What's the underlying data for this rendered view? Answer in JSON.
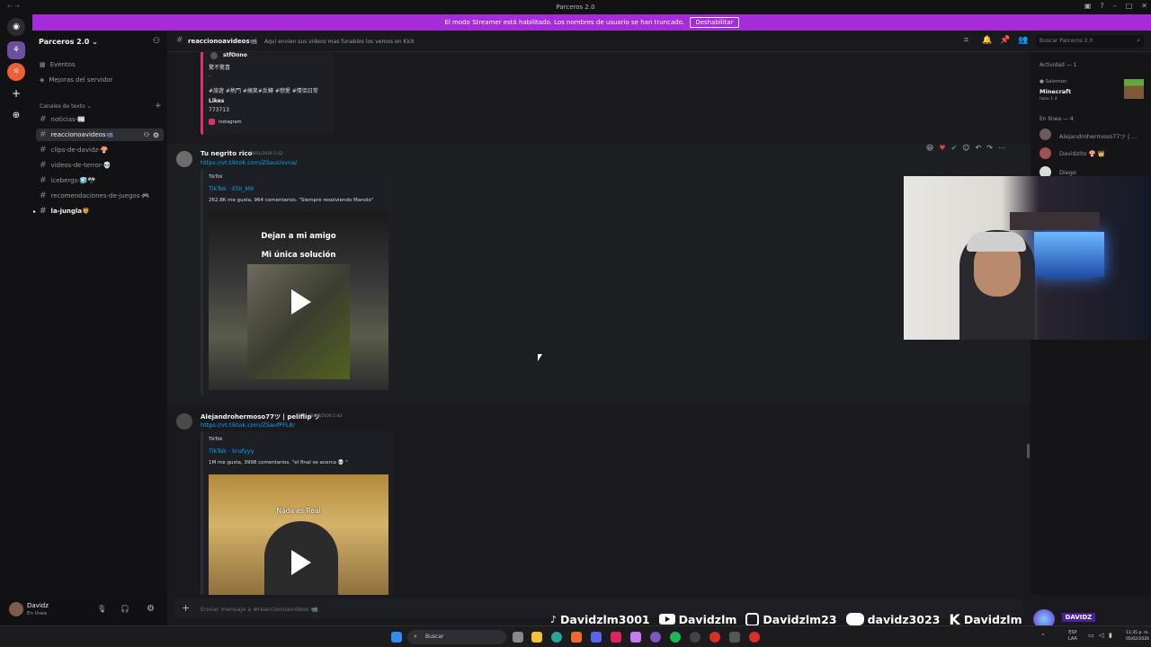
{
  "window": {
    "title": "Parceros 2.0",
    "nav": "← →"
  },
  "banner": {
    "text": "El modo Streamer está habilitado. Los nombres de usuario se han truncado.",
    "button": "Deshabilitar"
  },
  "sidebar": {
    "guild_name": "Parceros 2.0",
    "items": [
      {
        "label": "Eventos"
      },
      {
        "label": "Mejoras del servidor"
      }
    ],
    "category": "Canales de texto",
    "channels": [
      {
        "name": "noticias-",
        "emoji": "📰"
      },
      {
        "name": "reaccionoavideos",
        "emoji": "📹"
      },
      {
        "name": "clips-de-davidz-",
        "emoji": "🍄"
      },
      {
        "name": "videos-de-terror-",
        "emoji": "💀"
      },
      {
        "name": "icebergs-",
        "emoji": "🧊🎌"
      },
      {
        "name": "recomendaciones-de-juegos-",
        "emoji": "🎮"
      },
      {
        "name": "la-jungla",
        "emoji": "🦁"
      }
    ]
  },
  "user": {
    "name": "Davidz",
    "status": "En línea"
  },
  "header": {
    "channel": "reaccionoavideos",
    "channel_emoji": "📹",
    "topic": "Aqui envien sus videos mas funables los vemos en Kick",
    "search_placeholder": "Buscar Parceros 2.0"
  },
  "messages": {
    "prev_embed": {
      "username": "stfOnno",
      "line1": "驚不驚喜",
      "dot": ".",
      "hashtags": "#旅遊 #熱門 #搞笑#反轉 #戀愛 #情侶日常",
      "likes_label": "Likes",
      "likes": "773713",
      "source": "Instagram"
    },
    "msg1": {
      "author": "Tu negrito rico",
      "time": "28/01/2026 1:32",
      "link": "https://vt.tiktok.com/ZSauUsvna/",
      "provider": "TikTok",
      "embed_title": "TikTok · EDI_M9",
      "description": "262.8K me gusta, 964 comentarios. \"Siempre resolviendo Manolo\"",
      "video_line1": "Dejan a mi amigo",
      "video_line2": "Mi única solución"
    },
    "msg2": {
      "author": "Alejandrohermoso77ツ | pelifliр ツ",
      "time": "28/01/2026 1:42",
      "link": "https://vt.tiktok.com/ZSaufPFL8/",
      "provider": "TikTok",
      "embed_title": "TikTok · krufyyy",
      "description": "1M me gusta, 3998 comentarios. \"el final se acerca 💀 \"",
      "video_text": "Nada es Real"
    }
  },
  "composer": {
    "placeholder": "Enviar mensaje a #reaccionoavideos 📹"
  },
  "members": {
    "activity_header": "Actividad — 1",
    "activity": {
      "user": "Salomón",
      "game": "Minecraft",
      "ago": "hace 1 d"
    },
    "online_header": "En línea — 4",
    "online": [
      {
        "name": "Alejandrohermoso77ツ | ..."
      },
      {
        "name": "Davidzito 🍄 👑"
      },
      {
        "name": "Diego"
      }
    ]
  },
  "overlay": {
    "tiktok": "Davidzlm3001",
    "youtube": "Davidzlm",
    "instagram": "Davidzlm23",
    "discord": "davidz3023",
    "kick": "Davidzlm",
    "logo": "DAVIDZ"
  },
  "taskbar": {
    "search": "Buscar",
    "lang1": "ESP",
    "lang2": "LAA",
    "time": "11:35 p. m.",
    "date": "05/02/2026"
  },
  "colors": {
    "accent": "#a62bd9",
    "link": "#00a8fc",
    "bg": "#1a1a1e"
  }
}
